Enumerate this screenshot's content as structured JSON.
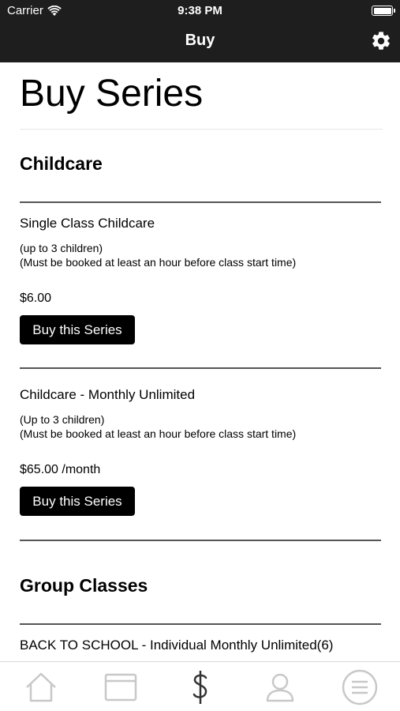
{
  "status_bar": {
    "carrier": "Carrier",
    "time": "9:38 PM"
  },
  "nav": {
    "title": "Buy",
    "settings_icon": "gear-icon"
  },
  "page": {
    "title": "Buy Series"
  },
  "sections": [
    {
      "title": "Childcare",
      "items": [
        {
          "name": "Single Class Childcare",
          "note_line1": "(up to 3 children)",
          "note_line2": "(Must be booked at least an hour before class start time)",
          "price": "$6.00",
          "button": "Buy this Series"
        },
        {
          "name": "Childcare - Monthly Unlimited",
          "note_line1": "(Up to 3 children)",
          "note_line2": "(Must be booked at least an hour before class start time)",
          "price": "$65.00 /month",
          "button": "Buy this Series"
        }
      ]
    },
    {
      "title": "Group Classes",
      "items": [
        {
          "name": "BACK TO SCHOOL - Individual Monthly Unlimited(6)"
        }
      ]
    }
  ],
  "tabbar": {
    "items": [
      "home-icon",
      "schedule-icon",
      "dollar-icon",
      "profile-icon",
      "menu-icon"
    ],
    "active": "dollar-icon"
  },
  "colors": {
    "header_bg": "#1e1e1e",
    "button_bg": "#000000",
    "tab_icon": "#c8c8c8",
    "tab_active": "#333333"
  }
}
